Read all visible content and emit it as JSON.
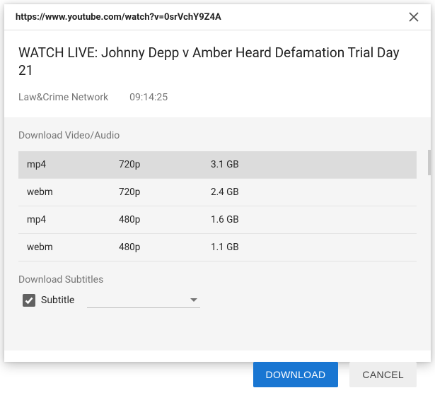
{
  "header": {
    "url": "https://www.youtube.com/watch?v=0srVchY9Z4A"
  },
  "video": {
    "title": "WATCH LIVE: Johnny Depp v Amber Heard Defamation Trial Day 21",
    "channel": "Law&Crime Network",
    "duration": "09:14:25"
  },
  "sections": {
    "video_audio_label": "Download Video/Audio",
    "subtitles_label": "Download Subtitles"
  },
  "formats": [
    {
      "format": "mp4",
      "quality": "720p",
      "size": "3.1 GB",
      "selected": true
    },
    {
      "format": "webm",
      "quality": "720p",
      "size": "2.4 GB",
      "selected": false
    },
    {
      "format": "mp4",
      "quality": "480p",
      "size": "1.6 GB",
      "selected": false
    },
    {
      "format": "webm",
      "quality": "480p",
      "size": "1.1 GB",
      "selected": false
    }
  ],
  "subtitle": {
    "checkbox_label": "Subtitle",
    "checked": true,
    "selected": ""
  },
  "actions": {
    "download": "DOWNLOAD",
    "cancel": "CANCEL"
  }
}
